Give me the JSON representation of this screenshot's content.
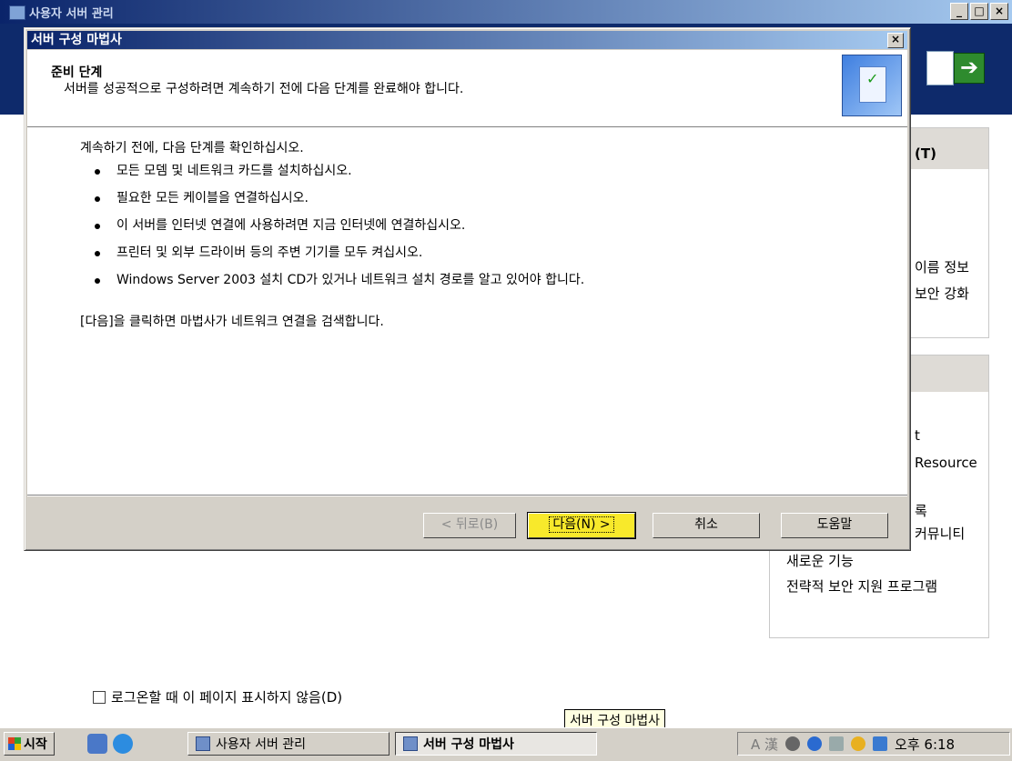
{
  "background_window": {
    "title": "사용자 서버 관리",
    "controls": [
      "_",
      "□",
      "×"
    ],
    "go_icon": "arrow-right-icon",
    "panel1": {
      "heading": "(T)",
      "items": [
        "이름 정보",
        "보안 강화"
      ]
    },
    "panel2": {
      "items": [
        "t",
        "Resource",
        "록",
        "커뮤니티",
        "새로운 기능",
        "전략적 보안 지원 프로그램"
      ]
    },
    "checkbox_label": "로그온할 때 이 페이지 표시하지 않음(D)"
  },
  "dialog": {
    "title": "서버 구성 마법사",
    "close_label": "×",
    "header": {
      "title": "준비 단계",
      "subtitle": "서버를 성공적으로 구성하려면 계속하기 전에 다음 단계를 완료해야 합니다.",
      "icon": "wizard-checklist-icon"
    },
    "body": {
      "intro": "계속하기 전에, 다음 단계를 확인하십시오.",
      "bullets": [
        "모든 모뎀 및 네트워크 카드를 설치하십시오.",
        "필요한 모든 케이블을 연결하십시오.",
        "이 서버를 인터넷 연결에 사용하려면 지금 인터넷에 연결하십시오.",
        "프린터 및 외부 드라이버 등의 주변 기기를 모두 켜십시오.",
        "Windows Server 2003 설치 CD가 있거나 네트워크 설치 경로를 알고 있어야 합니다."
      ],
      "closing": "[다음]을 클릭하면 마법사가 네트워크 연결을 검색합니다."
    },
    "buttons": {
      "back": "< 뒤로(B)",
      "next": "다음(N) >",
      "cancel": "취소",
      "help": "도움말"
    }
  },
  "tooltip": "서버 구성 마법사",
  "taskbar": {
    "start": "시작",
    "tasks": [
      "사용자 서버 관리",
      "서버 구성 마법사"
    ],
    "ime": "A 漢",
    "clock": "오후 6:18"
  }
}
